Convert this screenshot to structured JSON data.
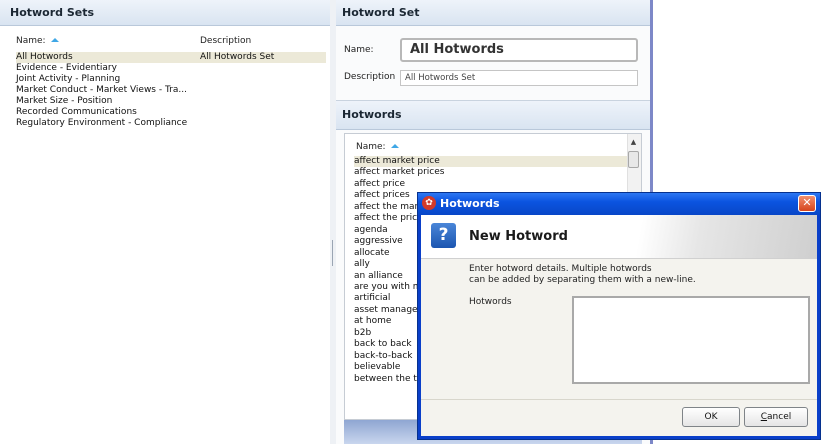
{
  "left_panel": {
    "title": "Hotword Sets",
    "columns": {
      "name": "Name:",
      "description": "Description"
    },
    "rows": [
      {
        "name": "All Hotwords",
        "description": "All Hotwords Set",
        "selected": true
      },
      {
        "name": "Evidence - Evidentiary",
        "description": ""
      },
      {
        "name": "Joint Activity - Planning",
        "description": ""
      },
      {
        "name": "Market Conduct - Market Views - Tra...",
        "description": ""
      },
      {
        "name": "Market Size - Position",
        "description": ""
      },
      {
        "name": "Recorded Communications",
        "description": ""
      },
      {
        "name": "Regulatory Environment - Compliance",
        "description": ""
      }
    ]
  },
  "right_panel": {
    "title": "Hotword Set",
    "name_label": "Name:",
    "name_value": "All Hotwords",
    "description_label": "Description",
    "description_value": "All Hotwords Set",
    "hotwords_title": "Hotwords",
    "hotwords_column": "Name:",
    "hotwords": [
      "affect market price",
      "affect market prices",
      "affect price",
      "affect prices",
      "affect the mar",
      "affect the pric",
      "agenda",
      "aggressive",
      "allocate",
      "ally",
      "an alliance",
      "are you with m",
      "artificial",
      "asset manager",
      "at home",
      "b2b",
      "back to back",
      "back-to-back",
      "believable",
      "between the t"
    ]
  },
  "dialog": {
    "title": "Hotwords",
    "heading": "New Hotword",
    "description_line1": "Enter hotword details. Multiple hotwords",
    "description_line2": "can be added by separating them with a new-line.",
    "field_label": "Hotwords",
    "field_value": "",
    "ok_label": "OK",
    "cancel_label": "Cancel",
    "close_glyph": "✕",
    "help_glyph": "?",
    "icons": [
      "app-icon",
      "help-icon",
      "close-icon"
    ]
  },
  "colors": {
    "titlebar": "#0b54e0",
    "sort_arrow": "#3fa7e6",
    "selection": "#ece9d8",
    "pane_border": "#7d88c8"
  }
}
